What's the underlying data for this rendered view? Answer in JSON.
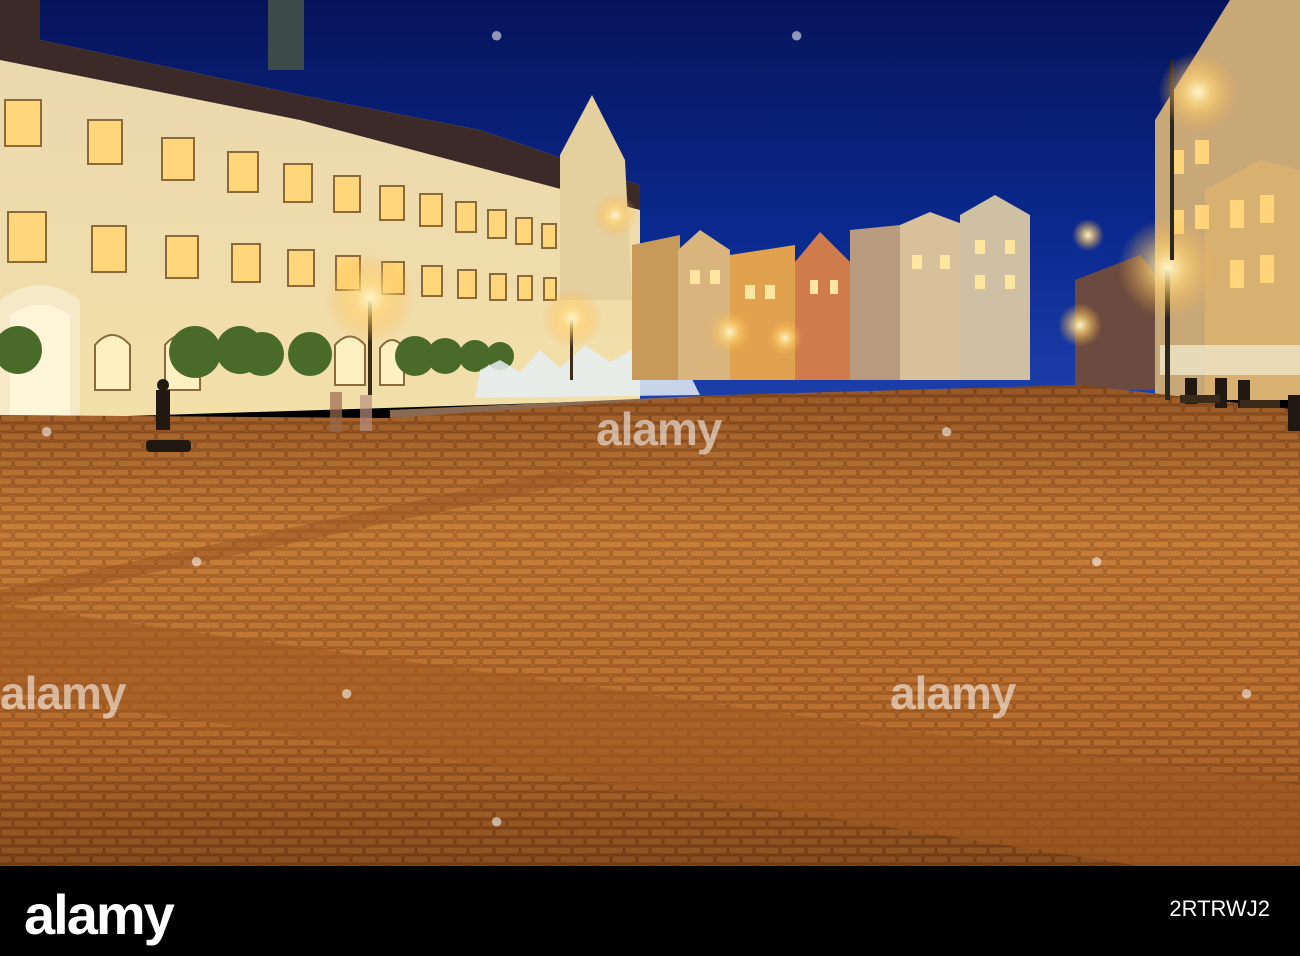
{
  "watermark": {
    "text": "alamy"
  },
  "footer": {
    "logo_text": "alamy",
    "image_code": "2RTRWJ2",
    "background": "#000000"
  },
  "scene": {
    "sky_color": "#0b1f6e",
    "cobblestone_color": "#b5692a",
    "lamp_color": "#ffe7a3"
  }
}
